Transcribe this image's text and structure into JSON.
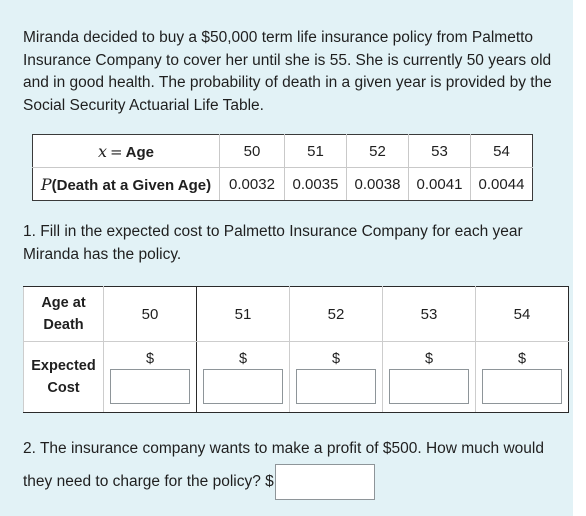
{
  "intro": "Miranda decided to buy a $50,000 term life insurance policy from Palmetto Insurance Company to cover her until she is 55. She is currently 50 years old and in good health. The probability of death in a given year is provided by the Social Security Actuarial Life Table.",
  "probability_table": {
    "row1_label_var": "x",
    "row1_label_eq": "=",
    "row1_label_text": "Age",
    "row2_label_var": "P",
    "row2_label_text": "(Death at a Given Age)",
    "ages": [
      "50",
      "51",
      "52",
      "53",
      "54"
    ],
    "probabilities": [
      "0.0032",
      "0.0035",
      "0.0038",
      "0.0041",
      "0.0044"
    ]
  },
  "question1": "1. Fill in the expected cost to Palmetto Insurance Company for each year Miranda has the policy.",
  "cost_table": {
    "age_label": "Age at Death",
    "cost_label": "Expected Cost",
    "ages": [
      "50",
      "51",
      "52",
      "53",
      "54"
    ],
    "currency_symbol": "$",
    "cost_values": [
      "",
      "",
      "",
      "",
      ""
    ]
  },
  "question2": {
    "text": "2. The insurance company wants to make a profit of $500. How much would they need to charge for the policy?",
    "currency_symbol": "$",
    "answer_value": ""
  }
}
